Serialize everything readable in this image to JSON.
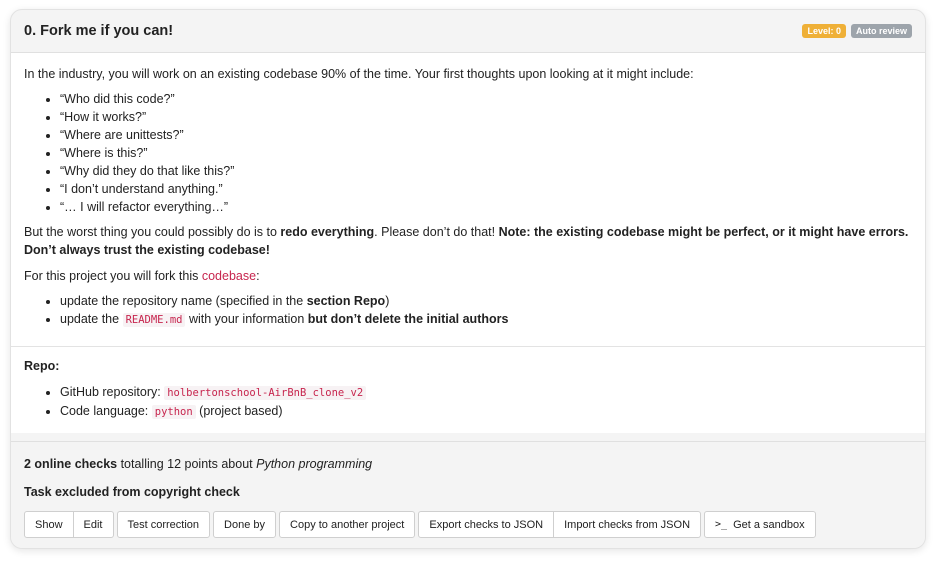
{
  "task": {
    "title": "0. Fork me if you can!",
    "badges": {
      "level": "Level: 0",
      "review": "Auto review"
    }
  },
  "intro": {
    "text": "In the industry, you will work on an existing codebase 90% of the time. Your first thoughts upon looking at it might include:",
    "thoughts": [
      "“Who did this code?”",
      "“How it works?”",
      "“Where are unittests?”",
      "“Where is this?”",
      "“Why did they do that like this?”",
      "“I don’t understand anything.”",
      "“… I will refactor everything…”"
    ]
  },
  "warning": {
    "prefix": "But the worst thing you could possibly do is to ",
    "bold1": "redo everything",
    "middle": ". Please don’t do that! ",
    "bold2": "Note: the existing codebase might be perfect, or it might have errors. Don’t always trust the existing codebase!"
  },
  "fork": {
    "prefix": "For this project you will fork this ",
    "link": "codebase",
    "suffix": ":",
    "item1": {
      "text": "update the repository name (specified in the ",
      "bold": "section Repo",
      "suffix": ")"
    },
    "item2": {
      "prefix": "update the ",
      "code": "README.md",
      "middle": " with your information ",
      "bold": "but don’t delete the initial authors"
    }
  },
  "repo": {
    "heading": "Repo:",
    "github_label": "GitHub repository: ",
    "github_value": "holbertonschool-AirBnB_clone_v2",
    "lang_label": "Code language: ",
    "lang_value": "python",
    "lang_suffix": " (project based)"
  },
  "checks": {
    "count": "2 online checks",
    "middle": " totalling 12 points about ",
    "topic": "Python programming",
    "excluded": "Task excluded from copyright check"
  },
  "buttons": {
    "show": "Show",
    "edit": "Edit",
    "test_correction": "Test correction",
    "done_by": "Done by",
    "copy": "Copy to another project",
    "export": "Export checks to JSON",
    "import": "Import checks from JSON",
    "sandbox_icon": ">_",
    "sandbox": "Get a sandbox"
  },
  "colors": {
    "level_badge": "#efb037",
    "review_badge": "#9da4ab",
    "link": "#c7254e"
  }
}
